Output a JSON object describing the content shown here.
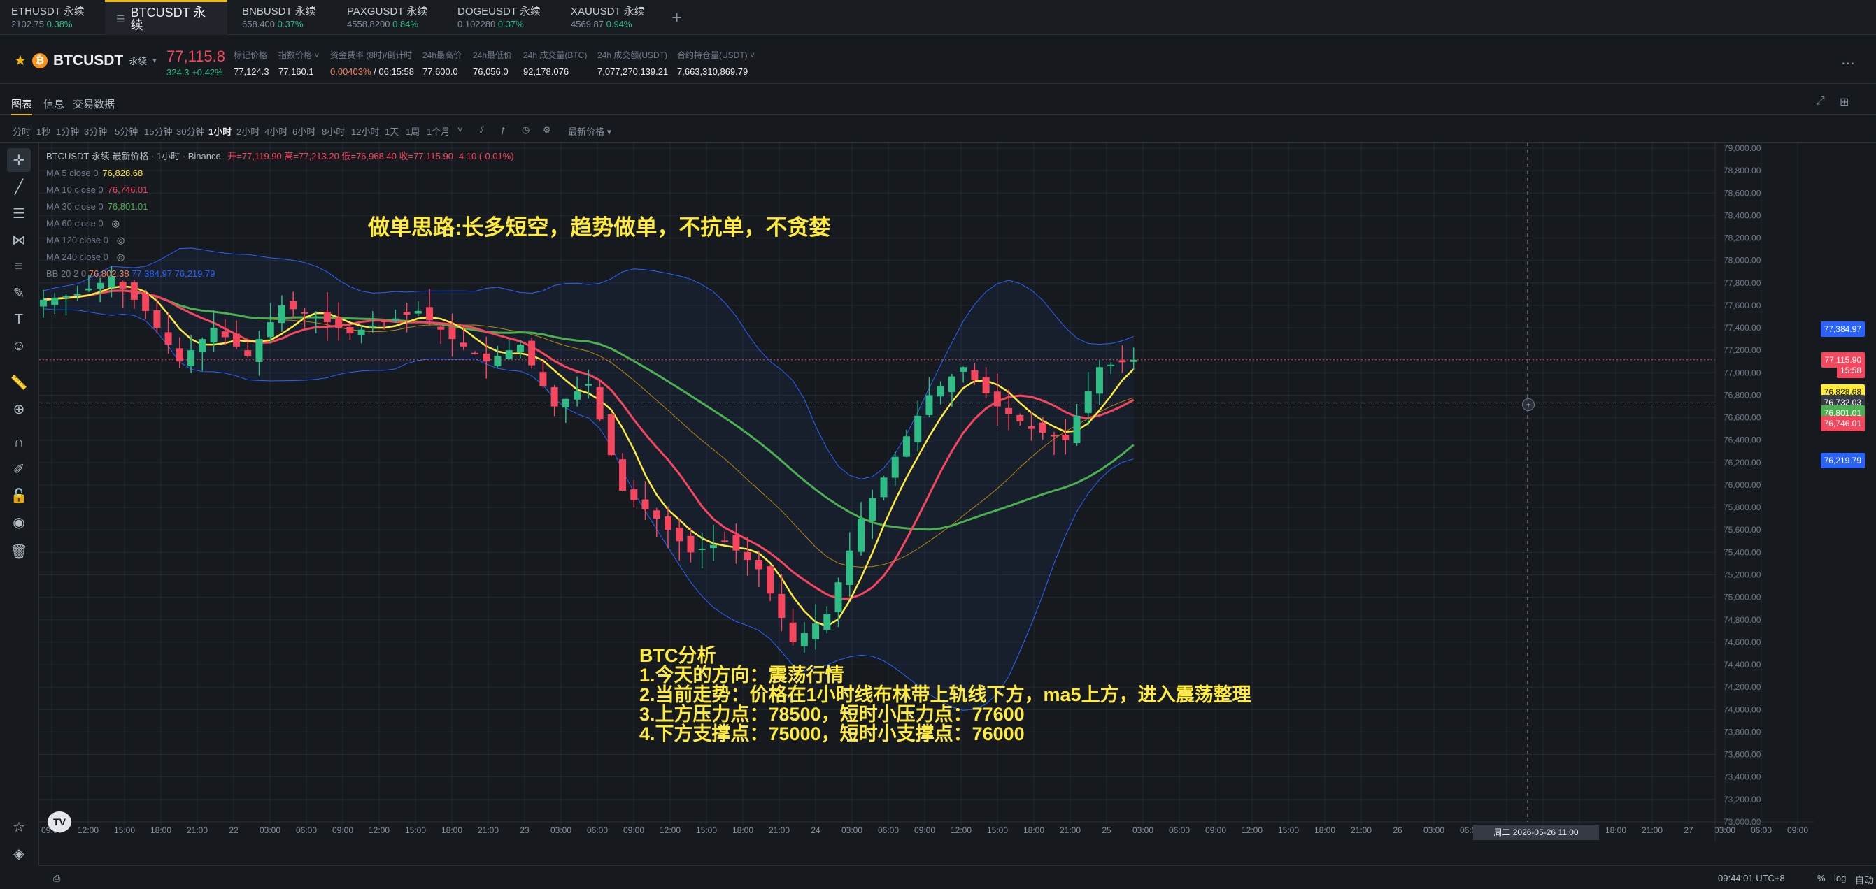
{
  "tabs": [
    {
      "name": "ETHUSDT 永续",
      "price": "2102.75",
      "change": "0.38%"
    },
    {
      "name": "BTCUSDT 永续",
      "active": true
    },
    {
      "name": "BNBUSDT 永续",
      "price": "658.400",
      "change": "0.37%"
    },
    {
      "name": "PAXGUSDT 永续",
      "price": "4558.8200",
      "change": "0.84%"
    },
    {
      "name": "DOGEUSDT 永续",
      "price": "0.102280",
      "change": "0.37%"
    },
    {
      "name": "XAUUSDT 永续",
      "price": "4569.87",
      "change": "0.94%"
    }
  ],
  "add_tab": "+",
  "header": {
    "symbol": "BTCUSDT",
    "contract": "永续",
    "price": "77,115.8",
    "change": "324.3 +0.42%",
    "stats": [
      {
        "label": "标记价格",
        "value": "77,124.3"
      },
      {
        "label": "指数价格 ˅",
        "value": "77,160.1"
      },
      {
        "label": "资金费率 (8时)/倒计时",
        "value_a": "0.00403%",
        "value_b": " / 06:15:58"
      },
      {
        "label": "24h最高价",
        "value": "77,600.0"
      },
      {
        "label": "24h最低价",
        "value": "76,056.0"
      },
      {
        "label": "24h 成交量(BTC)",
        "value": "92,178.076"
      },
      {
        "label": "24h 成交额(USDT)",
        "value": "7,077,270,139.21"
      },
      {
        "label": "合约持仓量(USDT) ˅",
        "value": "7,663,310,869.79"
      }
    ]
  },
  "subtabs": [
    "图表",
    "信息",
    "交易数据"
  ],
  "timeframes": [
    "分时",
    "1秒",
    "1分钟",
    "3分钟",
    "5分钟",
    "15分钟",
    "30分钟",
    "1小时",
    "2小时",
    "4小时",
    "6小时",
    "8小时",
    "12小时",
    "1天",
    "1周",
    "1个月",
    "˅"
  ],
  "active_timeframe": "1小时",
  "latest_price_menu": "最新价格 ▾",
  "legend": {
    "title": "BTCUSDT 永续 最新价格 · 1小时 · Binance",
    "ohlc": "开=77,119.90 高=77,213.20 低=76,968.40 收=77,115.90 -4.10 (-0.01%)",
    "ma": [
      {
        "label": "MA 5 close 0",
        "value": "76,828.68",
        "color": "#ffeb3b"
      },
      {
        "label": "MA 10 close 0",
        "value": "76,746.01",
        "color": "#f6465d"
      },
      {
        "label": "MA 30 close 0",
        "value": "76,801.01",
        "color": "#4caf50"
      },
      {
        "label": "MA 60 close 0",
        "value": "",
        "color": "#707a8a"
      },
      {
        "label": "MA 120 close 0",
        "value": "",
        "color": "#707a8a"
      },
      {
        "label": "MA 240 close 0",
        "value": "",
        "color": "#707a8a"
      }
    ],
    "bb": {
      "label": "BB 20 2 0",
      "v1": "76,802.38",
      "v2": "77,384.97",
      "v3": "76,219.79"
    }
  },
  "annotations": {
    "strategy": "做单思路:长多短空，趋势做单，不抗单，不贪婪",
    "analysis": "BTC分析\n1.今天的方向：震荡行情\n2.当前走势：价格在1小时线布林带上轨线下方，ma5上方，进入震荡整理\n3.上方压力点：78500，短时小压力点：77600\n4.下方支撑点：75000，短时小支撑点：76000"
  },
  "price_axis": [
    "79,000.00",
    "78,800.00",
    "78,600.00",
    "78,400.00",
    "78,200.00",
    "78,000.00",
    "77,800.00",
    "77,600.00",
    "77,400.00",
    "77,200.00",
    "77,000.00",
    "76,800.00",
    "76,600.00",
    "76,400.00",
    "76,200.00",
    "76,000.00",
    "75,800.00",
    "75,600.00",
    "75,400.00",
    "75,200.00",
    "75,000.00",
    "74,800.00",
    "74,600.00",
    "74,400.00",
    "74,200.00",
    "74,000.00",
    "73,800.00",
    "73,600.00",
    "73,400.00",
    "73,200.00",
    "73,000.00"
  ],
  "price_labels": [
    {
      "text": "77,384.97",
      "value": 77384.97,
      "bg": "#2962ff"
    },
    {
      "text": "77,115.90",
      "value": 77115.9,
      "bg": "#f6465d"
    },
    {
      "text": "15:58",
      "value": 77020,
      "bg": "#f6465d"
    },
    {
      "text": "76,828.68",
      "value": 76828.68,
      "bg": "#ffeb3b",
      "fg": "#131722"
    },
    {
      "text": "76,732.03",
      "value": 76732.03,
      "bg": "#363a45"
    },
    {
      "text": "76,801.01",
      "value": 76640,
      "bg": "#4caf50"
    },
    {
      "text": "76,746.01",
      "value": 76545,
      "bg": "#f6465d"
    },
    {
      "text": "76,219.79",
      "value": 76219.79,
      "bg": "#2962ff"
    }
  ],
  "time_axis": [
    "09:00",
    "12:00",
    "15:00",
    "18:00",
    "21:00",
    "22",
    "03:00",
    "06:00",
    "09:00",
    "12:00",
    "15:00",
    "18:00",
    "21:00",
    "23",
    "03:00",
    "06:00",
    "09:00",
    "12:00",
    "15:00",
    "18:00",
    "21:00",
    "24",
    "03:00",
    "06:00",
    "09:00",
    "12:00",
    "15:00",
    "18:00",
    "21:00",
    "25",
    "03:00",
    "06:00",
    "09:00",
    "12:00",
    "15:00",
    "18:00",
    "21:00",
    "26",
    "03:00",
    "06:00",
    "09:00",
    "12:00",
    "15:00",
    "18:00",
    "21:00",
    "27",
    "03:00",
    "06:00",
    "09:00"
  ],
  "crosshair_time": "周二 2026-05-26  11:00",
  "clock": "09:44:01 UTC+8",
  "bottom_right": [
    "%",
    "log",
    "自动"
  ],
  "colors": {
    "up": "#2ebd85",
    "down": "#f6465d",
    "ma5": "#ffeb3b",
    "ma10": "#f6465d",
    "ma30": "#4caf50",
    "ma60": "#b8860b",
    "bb": "#2962ff"
  },
  "chart_data": {
    "type": "candlestick",
    "interval": "1小时",
    "ylim": [
      72900,
      79000
    ],
    "x": [
      "22 09:00",
      "22 12:00",
      "22 15:00",
      "22 18:00",
      "22 21:00",
      "23 00:00",
      "23 03:00",
      "23 06:00",
      "23 09:00",
      "23 12:00",
      "23 15:00",
      "23 18:00",
      "23 21:00",
      "24 00:00",
      "24 03:00",
      "24 06:00",
      "24 09:00",
      "24 12:00",
      "24 15:00",
      "24 18:00",
      "24 21:00",
      "25 00:00",
      "25 03:00",
      "25 06:00",
      "25 09:00",
      "25 12:00",
      "25 15:00",
      "25 18:00",
      "25 21:00",
      "26 00:00",
      "26 03:00",
      "26 06:00",
      "26 09:00"
    ],
    "close_approx": [
      77650,
      77700,
      77850,
      77550,
      77100,
      77400,
      77150,
      77600,
      77500,
      77350,
      77450,
      77550,
      77300,
      77100,
      77250,
      76700,
      76900,
      75950,
      75700,
      75400,
      75500,
      75250,
      74600,
      74850,
      75700,
      76250,
      76800,
      77050,
      76700,
      76500,
      76400,
      77050,
      77115
    ]
  }
}
